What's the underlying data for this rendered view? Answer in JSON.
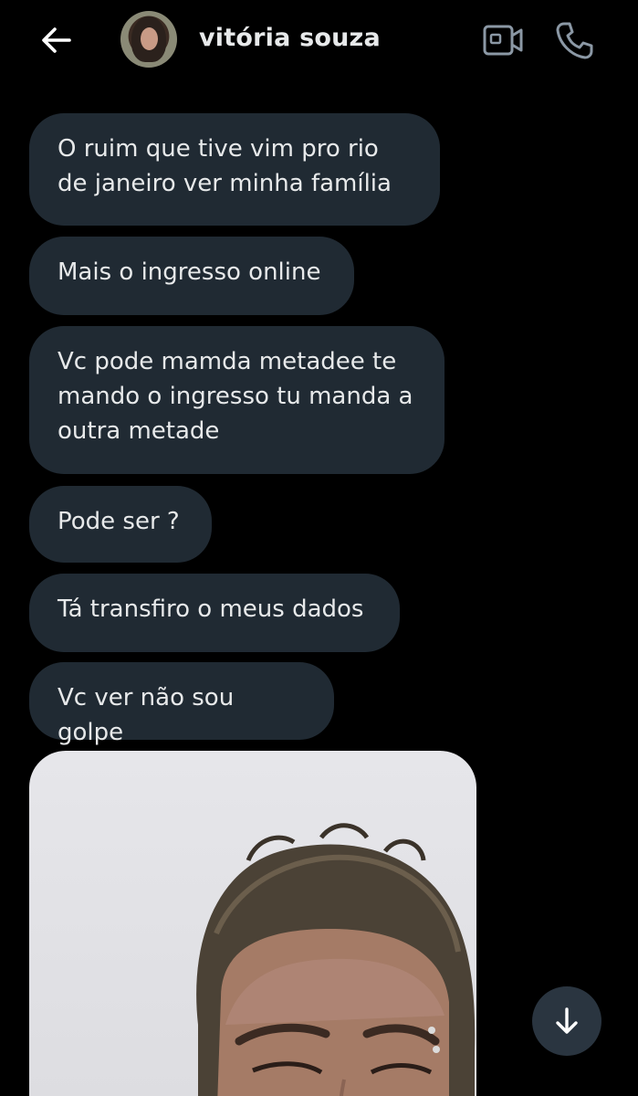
{
  "header": {
    "contact_name": "vitória souza",
    "icons": {
      "back": "back-arrow-icon",
      "video": "video-camera-icon",
      "call": "phone-icon"
    }
  },
  "messages": [
    {
      "text": "O ruim que tive vim pro rio de janeiro ver minha família"
    },
    {
      "text": "Mais o ingresso online"
    },
    {
      "text": "Vc pode mamda metadee te mando o ingresso tu manda a outra metade"
    },
    {
      "text": "Pode ser ?"
    },
    {
      "text": "Tá transfiro o meus dados"
    },
    {
      "text": "Vc ver não sou golpe"
    }
  ],
  "colors": {
    "background": "#000000",
    "bubble": "#202a33",
    "text": "#e7e9ea",
    "icon": "#8b98a5",
    "scroll_button": "#2a3540"
  },
  "scroll_button": {
    "icon": "arrow-down-icon"
  }
}
